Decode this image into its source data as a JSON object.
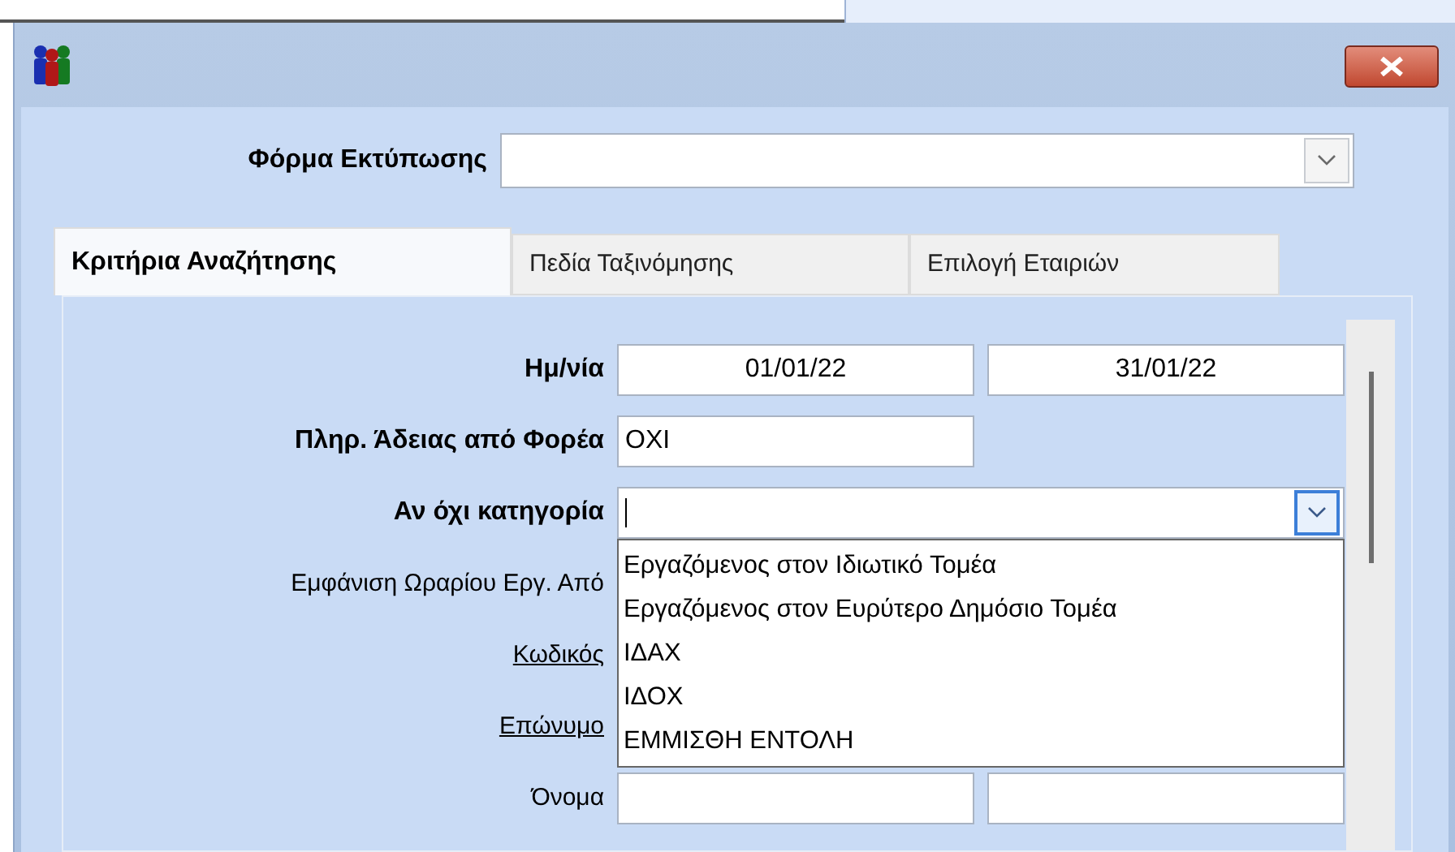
{
  "print_form": {
    "label": "Φόρμα Εκτύπωσης"
  },
  "tabs": [
    {
      "label": "Κριτήρια Αναζήτησης",
      "selected": true
    },
    {
      "label": "Πεδία Ταξινόμησης",
      "selected": false
    },
    {
      "label": "Επιλογή Εταιριών",
      "selected": false
    }
  ],
  "rows": [
    {
      "kind": "range",
      "bold": true,
      "link": false,
      "label": "Ημ/νία",
      "from": "01/01/22",
      "to": "31/01/22"
    },
    {
      "kind": "text",
      "bold": true,
      "link": false,
      "label": "Πληρ. Άδειας από Φορέα",
      "value": "ΟΧΙ"
    },
    {
      "kind": "combo",
      "bold": true,
      "link": false,
      "label": "Αν όχι κατηγορία",
      "expanded": true,
      "options": [
        "Εργαζόμενος στον Ιδιωτικό Τομέα",
        "Εργαζόμενος στον Ευρύτερο Δημόσιο Τομέα",
        "ΙΔΑΧ",
        "ΙΔΟΧ",
        "ΕΜΜΙΣΘΗ ΕΝΤΟΛΗ"
      ]
    },
    {
      "kind": "label",
      "bold": false,
      "link": false,
      "label": "Εμφάνιση Ωραρίου Εργ. Από"
    },
    {
      "kind": "label",
      "bold": false,
      "link": true,
      "label": "Κωδικός"
    },
    {
      "kind": "label",
      "bold": false,
      "link": true,
      "label": "Επώνυμο"
    },
    {
      "kind": "range",
      "bold": false,
      "link": false,
      "label": "Όνομα"
    }
  ]
}
